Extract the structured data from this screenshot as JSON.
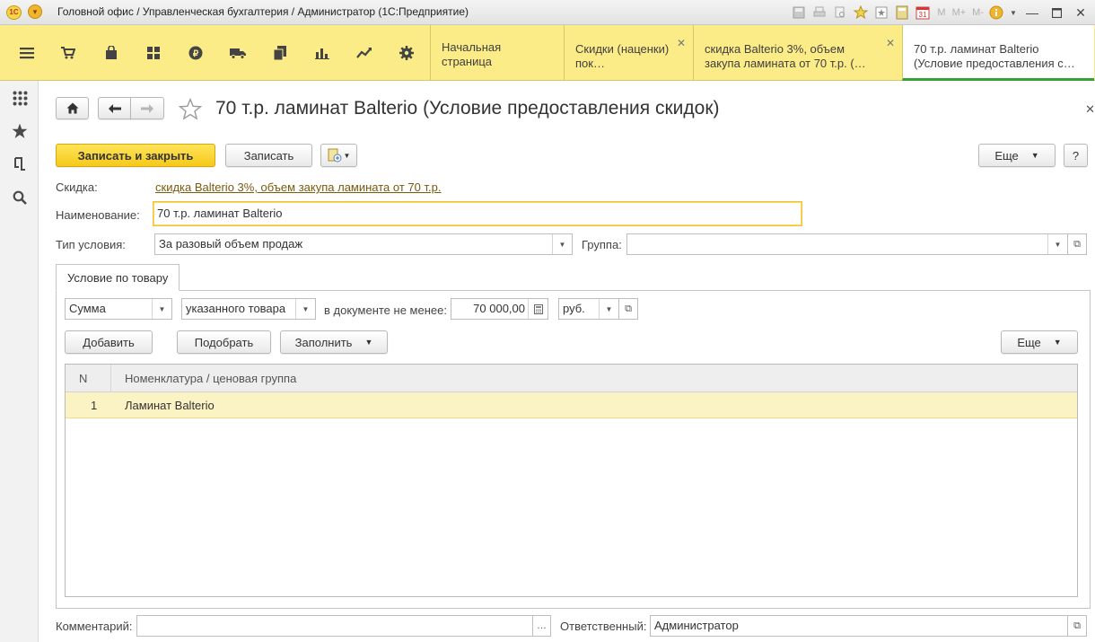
{
  "titlebar": {
    "title": "Головной офис / Управленческая бухгалтерия / Администратор  (1С:Предприятие)",
    "logo_text": "1С",
    "m_label": "M",
    "m_plus_label": "M+",
    "m_minus_label": "M-",
    "calendar_day": "31"
  },
  "tabs": [
    {
      "label": "Начальная страница"
    },
    {
      "label": "Скидки (наценки) пок…"
    },
    {
      "label": "скидка Balterio 3%, объем закупа ламината от 70 т.р. (…"
    },
    {
      "label": "70 т.р. ламинат Balterio (Условие предоставления с…"
    }
  ],
  "form": {
    "title": "70 т.р. ламинат Balterio (Условие предоставления скидок)",
    "save_close_label": "Записать и закрыть",
    "save_label": "Записать",
    "more_label": "Еще",
    "help_label": "?",
    "discount_label": "Скидка:",
    "discount_value": "скидка Balterio 3%, объем закупа ламината от 70 т.р.",
    "name_label": "Наименование:",
    "name_value": "70 т.р. ламинат Balterio",
    "condition_type_label": "Тип условия:",
    "condition_type_value": "За разовый объем продаж",
    "group_label": "Группа:",
    "group_value": ""
  },
  "page_tab": {
    "label": "Условие по товару",
    "measure_value": "Сумма",
    "scope_value": "указанного товара",
    "min_label": "в документе не менее:",
    "min_amount": "70 000,00",
    "currency_value": "руб.",
    "add_label": "Добавить",
    "pick_label": "Подобрать",
    "fill_label": "Заполнить",
    "more_label": "Еще"
  },
  "table": {
    "columns": [
      "N",
      "Номенклатура / ценовая группа"
    ],
    "rows": [
      {
        "n": "1",
        "item": "Ламинат Balterio"
      }
    ]
  },
  "footer": {
    "comment_label": "Комментарий:",
    "comment_value": "",
    "responsible_label": "Ответственный:",
    "responsible_value": "Администратор"
  },
  "colors": {
    "section_bar": "#fbec88",
    "primary_button": "#f5c919",
    "selected_row": "#fbf3c4",
    "active_tab_underline": "#35a035",
    "link": "#7a5a0c"
  }
}
